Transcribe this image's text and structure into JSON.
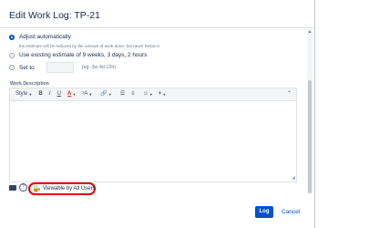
{
  "dialog": {
    "title": "Edit Work Log: TP-21"
  },
  "estimate": {
    "option_auto": "Adjust automatically",
    "option_auto_hint": "the estimate will be reduced by the amount of work done, but never below 0.",
    "option_existing": "Use existing estimate of 9 weeks, 3 days, 2 hours",
    "option_set": "Set to",
    "option_set_value": "",
    "option_set_hint": "(eg. 3w 4d 12h)"
  },
  "description": {
    "label": "Work Description",
    "value": ""
  },
  "toolbar": {
    "style": "Style",
    "bold": "B",
    "italic": "I",
    "underline": "U",
    "text_color": "A",
    "text_size": "ˢA",
    "link": "🔗",
    "bullets": "☰",
    "numbered": "≡",
    "emoji": "☺",
    "insert": "+",
    "collapse": "⌃"
  },
  "visibility": {
    "label": "Viewable by All Users",
    "icon": "lock-icon"
  },
  "actions": {
    "log": "Log",
    "cancel": "Cancel"
  },
  "colors": {
    "primary": "#0052cc",
    "highlight": "#e30000"
  }
}
